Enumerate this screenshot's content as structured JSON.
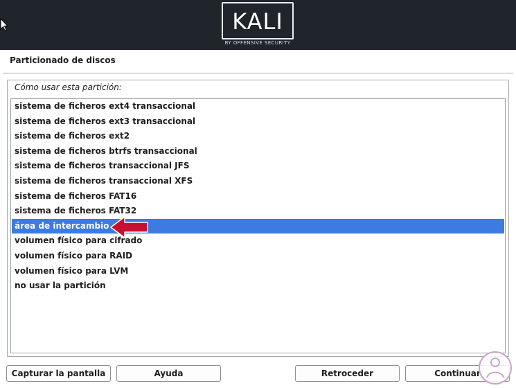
{
  "banner": {
    "logo_text": "KALI",
    "logo_subtitle": "BY OFFENSIVE SECURITY"
  },
  "window": {
    "title": "Particionado de discos"
  },
  "question": "Cómo usar esta partición:",
  "options": [
    "sistema de ficheros ext4 transaccional",
    "sistema de ficheros ext3 transaccional",
    "sistema de ficheros ext2",
    "sistema de ficheros btrfs transaccional",
    "sistema de ficheros transaccional JFS",
    "sistema de ficheros transaccional XFS",
    "sistema de ficheros FAT16",
    "sistema de ficheros FAT32",
    "área de intercambio",
    "volumen físico para cifrado",
    "volumen físico para RAID",
    "volumen físico para LVM",
    "no usar la partición"
  ],
  "selected_option": "área de intercambio",
  "buttons": {
    "screenshot": "Capturar la pantalla",
    "help": "Ayuda",
    "back": "Retroceder",
    "continue": "Continuar"
  },
  "colors": {
    "banner": "#20252c",
    "selection": "#3d7be0",
    "arrow": "#c8102e"
  }
}
